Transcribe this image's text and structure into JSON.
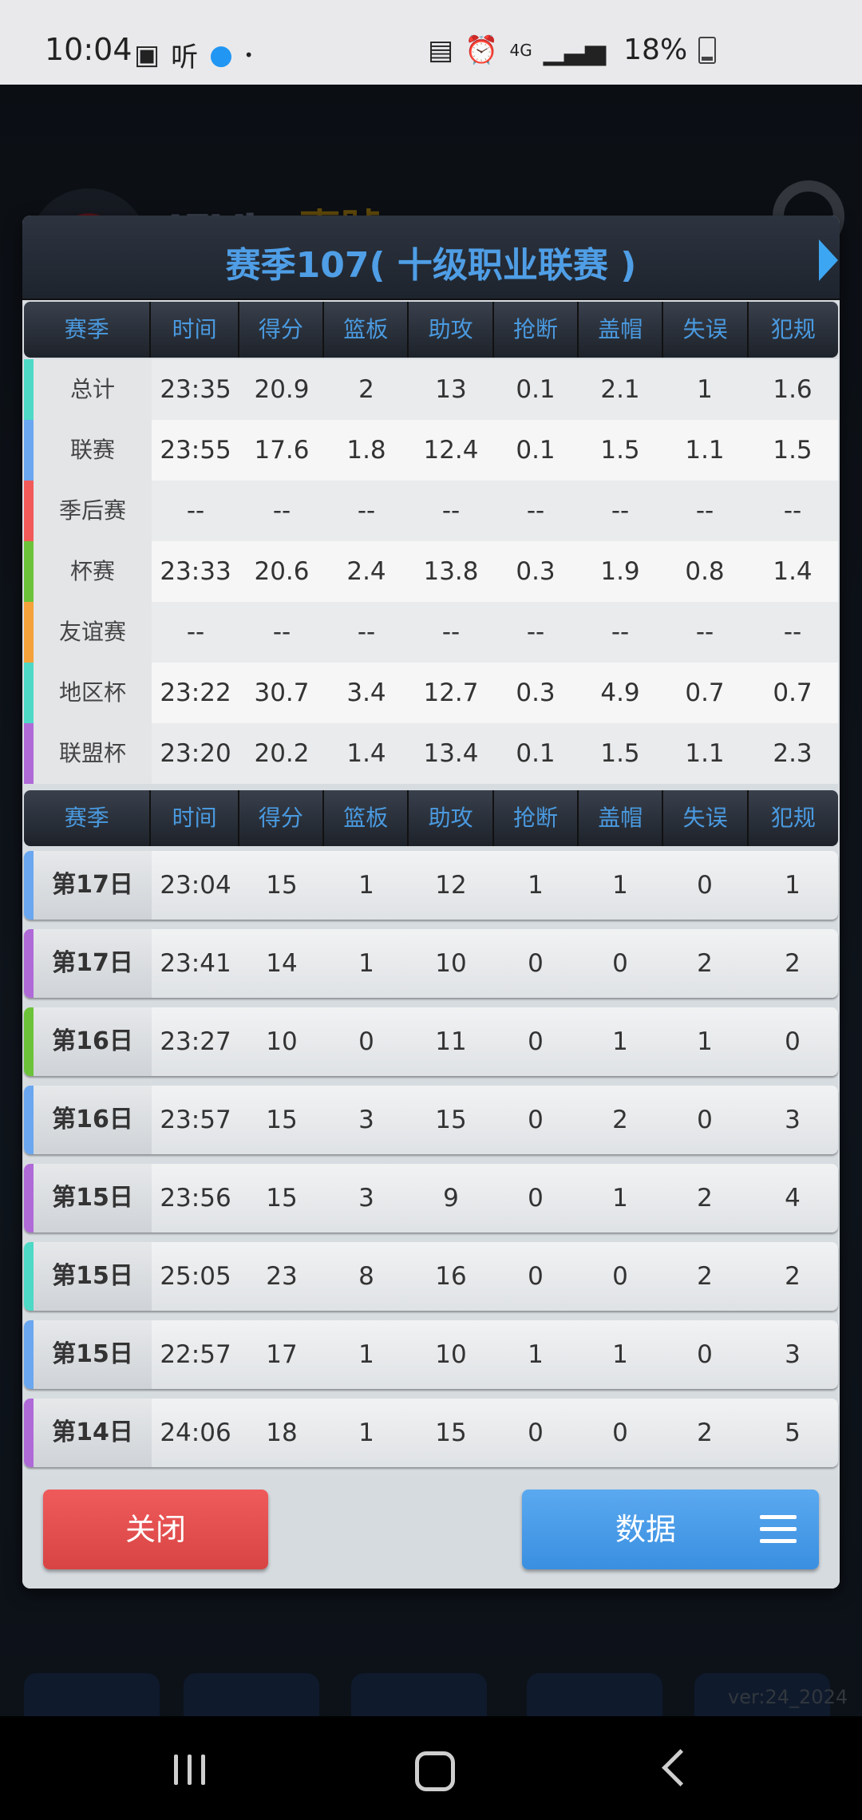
{
  "status_bar": {
    "time": "10:04",
    "left_icons": [
      "image-icon",
      "ting-app-icon",
      "qq-icon",
      "dot-icon"
    ],
    "listen_text": "听",
    "right_icons": [
      "sim-lock-icon",
      "alarm-icon",
      "4g-icon",
      "signal-icon",
      "battery-icon"
    ],
    "net_text": "4G",
    "battery_pct": "18%"
  },
  "background": {
    "player_name_prefix": "JFVic",
    "player_name_suffix": "-壹號",
    "version": "ver:24_2024"
  },
  "modal": {
    "title": "赛季107( 十级职业联赛 )",
    "summary_headers": [
      "赛季",
      "时间",
      "得分",
      "篮板",
      "助攻",
      "抢断",
      "盖帽",
      "失误",
      "犯规"
    ],
    "summary_rows": [
      {
        "label": "总计",
        "color": "#4dd9c6",
        "values": [
          "23:35",
          "20.9",
          "2",
          "13",
          "0.1",
          "2.1",
          "1",
          "1.6"
        ]
      },
      {
        "label": "联赛",
        "color": "#6aa7f0",
        "values": [
          "23:55",
          "17.6",
          "1.8",
          "12.4",
          "0.1",
          "1.5",
          "1.1",
          "1.5"
        ]
      },
      {
        "label": "季后赛",
        "color": "#f25a5a",
        "values": [
          "--",
          "--",
          "--",
          "--",
          "--",
          "--",
          "--",
          "--"
        ]
      },
      {
        "label": "杯赛",
        "color": "#6cc33a",
        "values": [
          "23:33",
          "20.6",
          "2.4",
          "13.8",
          "0.3",
          "1.9",
          "0.8",
          "1.4"
        ]
      },
      {
        "label": "友谊赛",
        "color": "#f5a23a",
        "values": [
          "--",
          "--",
          "--",
          "--",
          "--",
          "--",
          "--",
          "--"
        ]
      },
      {
        "label": "地区杯",
        "color": "#4dd9c6",
        "values": [
          "23:22",
          "30.7",
          "3.4",
          "12.7",
          "0.3",
          "4.9",
          "0.7",
          "0.7"
        ]
      },
      {
        "label": "联盟杯",
        "color": "#b06ad8",
        "values": [
          "23:20",
          "20.2",
          "1.4",
          "13.4",
          "0.1",
          "1.5",
          "1.1",
          "2.3"
        ]
      }
    ],
    "game_headers": [
      "赛季",
      "时间",
      "得分",
      "篮板",
      "助攻",
      "抢断",
      "盖帽",
      "失误",
      "犯规"
    ],
    "game_rows": [
      {
        "label": "第17日",
        "color": "#6aa7f0",
        "values": [
          "23:04",
          "15",
          "1",
          "12",
          "1",
          "1",
          "0",
          "1"
        ]
      },
      {
        "label": "第17日",
        "color": "#b06ad8",
        "values": [
          "23:41",
          "14",
          "1",
          "10",
          "0",
          "0",
          "2",
          "2"
        ]
      },
      {
        "label": "第16日",
        "color": "#6cc33a",
        "values": [
          "23:27",
          "10",
          "0",
          "11",
          "0",
          "1",
          "1",
          "0"
        ]
      },
      {
        "label": "第16日",
        "color": "#6aa7f0",
        "values": [
          "23:57",
          "15",
          "3",
          "15",
          "0",
          "2",
          "0",
          "3"
        ]
      },
      {
        "label": "第15日",
        "color": "#b06ad8",
        "values": [
          "23:56",
          "15",
          "3",
          "9",
          "0",
          "1",
          "2",
          "4"
        ]
      },
      {
        "label": "第15日",
        "color": "#4dd9c6",
        "values": [
          "25:05",
          "23",
          "8",
          "16",
          "0",
          "0",
          "2",
          "2"
        ]
      },
      {
        "label": "第15日",
        "color": "#6aa7f0",
        "values": [
          "22:57",
          "17",
          "1",
          "10",
          "1",
          "1",
          "0",
          "3"
        ]
      },
      {
        "label": "第14日",
        "color": "#b06ad8",
        "values": [
          "24:06",
          "18",
          "1",
          "15",
          "0",
          "0",
          "2",
          "5"
        ]
      }
    ],
    "close_label": "关闭",
    "data_label": "数据"
  }
}
